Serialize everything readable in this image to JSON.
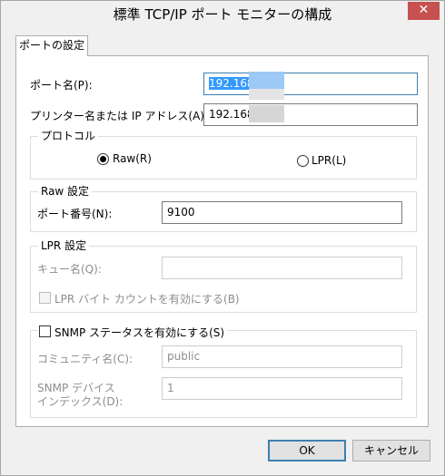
{
  "window": {
    "title": "標準 TCP/IP ポート モニターの構成",
    "close_label": "✕"
  },
  "tab": {
    "label": "ポートの設定"
  },
  "port_name": {
    "label": "ポート名(P):",
    "value": "192.168"
  },
  "printer_address": {
    "label": "プリンター名または IP アドレス(A):",
    "value": "192.168"
  },
  "protocol": {
    "legend": "プロトコル",
    "raw_label": "Raw(R)",
    "lpr_label": "LPR(L)",
    "selected": "Raw"
  },
  "raw_settings": {
    "legend": "Raw 設定",
    "port_number_label": "ポート番号(N):",
    "port_number_value": "9100"
  },
  "lpr_settings": {
    "legend": "LPR 設定",
    "queue_name_label": "キュー名(Q):",
    "queue_name_value": "",
    "byte_count_label": "LPR バイト カウントを有効にする(B)"
  },
  "snmp": {
    "legend": "SNMP ステータスを有効にする(S)",
    "community_label": "コミュニティ名(C):",
    "community_value": "public",
    "device_index_label_line1": "SNMP デバイス",
    "device_index_label_line2": "インデックス(D):",
    "device_index_value": "1"
  },
  "buttons": {
    "ok": "OK",
    "cancel": "キャンセル"
  },
  "colors": {
    "accent": "#3399ff",
    "close": "#c75050",
    "disabled_text": "#8d8d8d"
  }
}
